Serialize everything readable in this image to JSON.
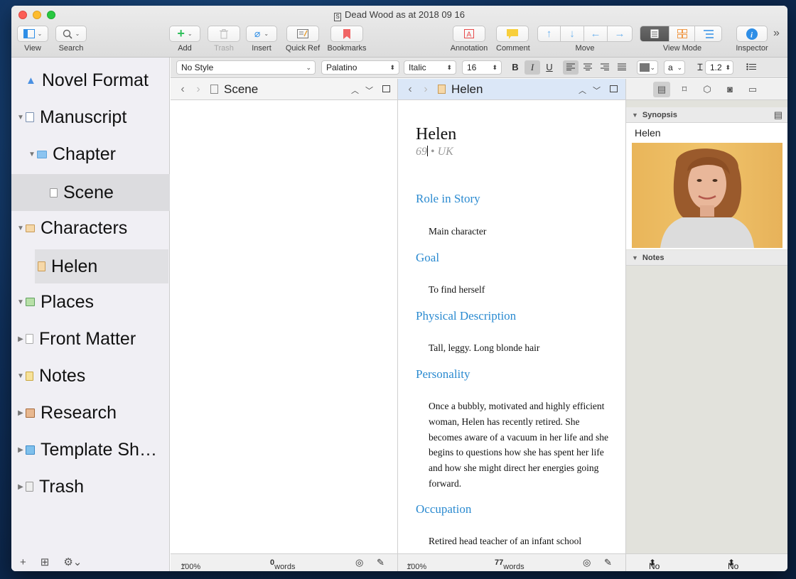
{
  "window": {
    "title": "Dead Wood as at 2018 09 16"
  },
  "toolbar": {
    "view": "View",
    "search": "Search",
    "add": "Add",
    "trash": "Trash",
    "insert": "Insert",
    "quick_ref": "Quick Ref",
    "bookmarks": "Bookmarks",
    "annotation": "Annotation",
    "comment": "Comment",
    "move": "Move",
    "view_mode": "View Mode",
    "inspector": "Inspector",
    "overflow": "»"
  },
  "binder": {
    "items": [
      {
        "label": "Novel Format",
        "disclosure": "",
        "icon": "warning-icon"
      },
      {
        "label": "Manuscript",
        "disclosure": "▼",
        "icon": "manuscript-icon"
      },
      {
        "label": "Chapter",
        "disclosure": "▼",
        "icon": "folder-icon"
      },
      {
        "label": "Scene",
        "disclosure": "",
        "icon": "document-icon"
      },
      {
        "label": "Characters",
        "disclosure": "▼",
        "icon": "character-icon"
      },
      {
        "label": "Helen",
        "disclosure": "",
        "icon": "character-sheet-icon"
      },
      {
        "label": "Places",
        "disclosure": "▼",
        "icon": "places-icon"
      },
      {
        "label": "Front Matter",
        "disclosure": "▶",
        "icon": "front-matter-icon"
      },
      {
        "label": "Notes",
        "disclosure": "▼",
        "icon": "notes-icon"
      },
      {
        "label": "Research",
        "disclosure": "▶",
        "icon": "research-icon"
      },
      {
        "label": "Template Sh…",
        "disclosure": "▶",
        "icon": "template-icon"
      },
      {
        "label": "Trash",
        "disclosure": "▶",
        "icon": "trash-icon"
      }
    ]
  },
  "formatbar": {
    "style": "No Style",
    "font": "Palatino",
    "typeface": "Italic",
    "size": "16",
    "bold": "B",
    "italic": "I",
    "underline": "U",
    "highlight": "a",
    "line_spacing": "1.2"
  },
  "left_pane": {
    "title": "Scene",
    "zoom": "100%",
    "word_count": "0",
    "words_label": "words"
  },
  "right_pane": {
    "title": "Helen",
    "zoom": "100%",
    "word_count": "77",
    "words_label": "words",
    "doc": {
      "name": "Helen",
      "subtitle_num": "69",
      "subtitle_sep": "•",
      "subtitle_place": "UK",
      "sections": [
        {
          "heading": "Role in Story",
          "body": "Main character"
        },
        {
          "heading": "Goal",
          "body": "To find herself"
        },
        {
          "heading": "Physical Description",
          "body": "Tall, leggy. Long blonde hair"
        },
        {
          "heading": "Personality",
          "body": "Once a bubbly, motivated and highly efficient woman, Helen has recently retired. She becomes aware of a vacuum in her life and she begins to questions how she has spent her life and how she might direct her energies going forward."
        },
        {
          "heading": "Occupation",
          "body": "Retired head teacher of an infant school"
        }
      ]
    }
  },
  "inspector": {
    "synopsis_label": "Synopsis",
    "synopsis_title": "Helen",
    "notes_label": "Notes",
    "label_value": "No Label",
    "status_value": "No Status"
  },
  "colors": {
    "heading_blue": "#2a8ad0",
    "add_green": "#2fbf5b",
    "bookmark_red": "#f06565",
    "comment_yellow": "#f8cf3c",
    "viewmode_orange": "#f09a4a",
    "inspector_blue": "#2e8ee6"
  }
}
